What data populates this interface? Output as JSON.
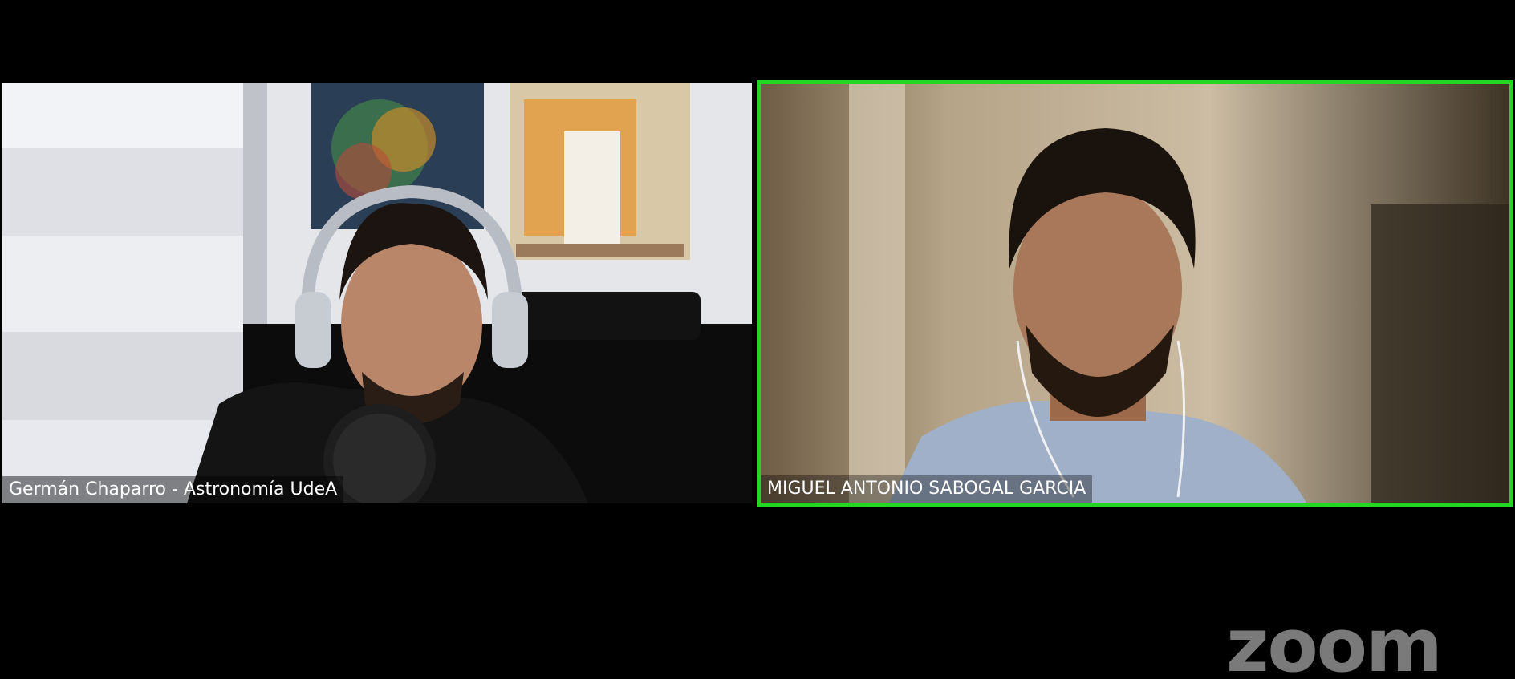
{
  "participants": [
    {
      "name": "Germán Chaparro - Astronomía UdeA",
      "active_speaker": false
    },
    {
      "name": "MIGUEL ANTONIO SABOGAL GARCIA",
      "active_speaker": true
    }
  ],
  "branding": {
    "logo_text": "zoom"
  },
  "colors": {
    "background": "#000000",
    "active_speaker_border": "#22d622",
    "logo": "#7a7a7a"
  }
}
